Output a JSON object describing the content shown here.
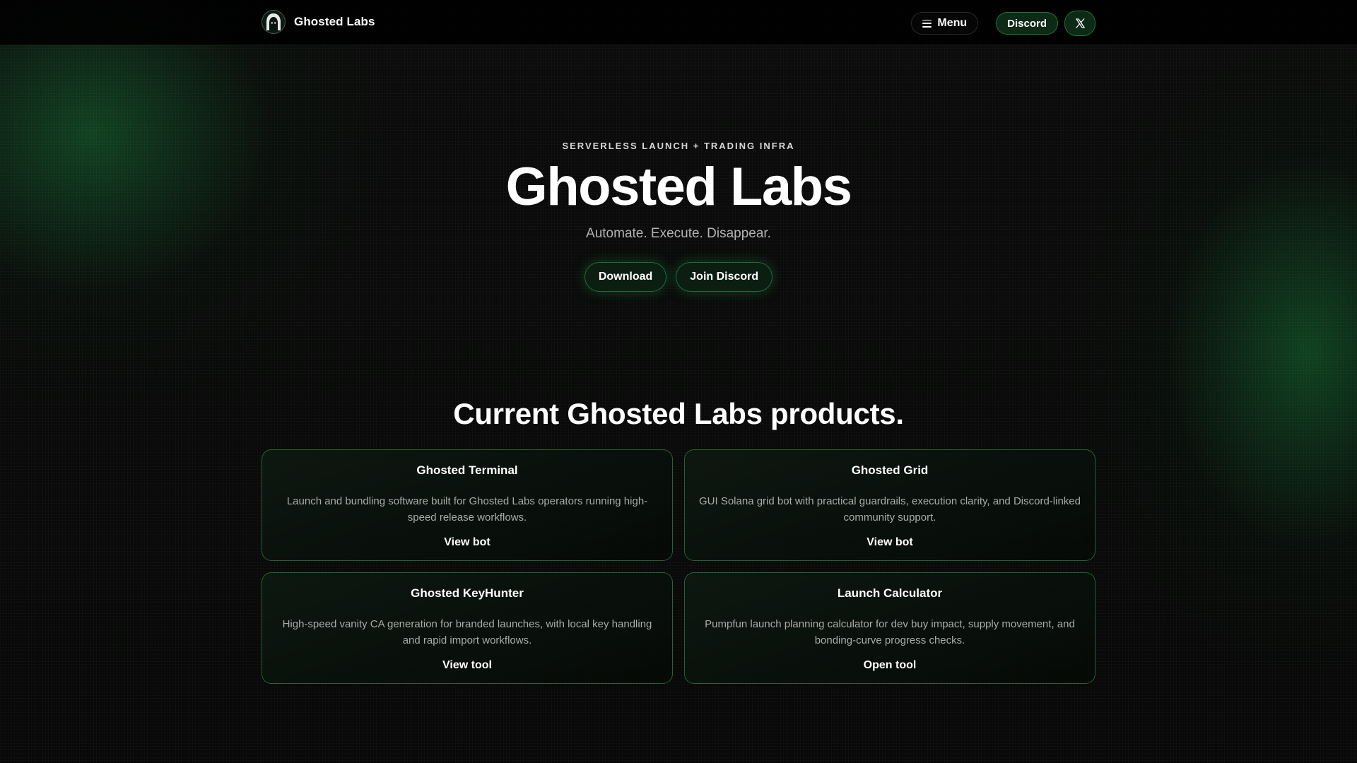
{
  "nav": {
    "brand_name": "Ghosted Labs",
    "menu_label": "Menu",
    "discord_label": "Discord",
    "x_label": "X"
  },
  "hero": {
    "eyebrow": "SERVERLESS LAUNCH + TRADING INFRA",
    "title": "Ghosted Labs",
    "tagline": "Automate. Execute. Disappear.",
    "download_label": "Download",
    "join_discord_label": "Join Discord"
  },
  "products": {
    "section_title": "Current Ghosted Labs products.",
    "items": [
      {
        "title": "Ghosted Terminal",
        "description": "Launch and bundling software built for Ghosted Labs operators running high-speed release workflows.",
        "link_label": "View bot"
      },
      {
        "title": "Ghosted Grid",
        "description": "GUI Solana grid bot with practical guardrails, execution clarity, and Discord-linked community support.",
        "link_label": "View bot"
      },
      {
        "title": "Ghosted KeyHunter",
        "description": "High-speed vanity CA generation for branded launches, with local key handling and rapid import workflows.",
        "link_label": "View tool"
      },
      {
        "title": "Launch Calculator",
        "description": "Pumpfun launch planning calculator for dev buy impact, supply movement, and bonding-curve progress checks.",
        "link_label": "Open tool"
      }
    ]
  },
  "icons": {
    "brand_logo": "hooded-ghost-icon",
    "menu": "hamburger-icon",
    "x": "x-logo-icon"
  },
  "colors": {
    "background": "#050605",
    "accent_green": "#2fb865",
    "button_fill": "#0d2a17",
    "muted_text": "#a9aca9"
  }
}
